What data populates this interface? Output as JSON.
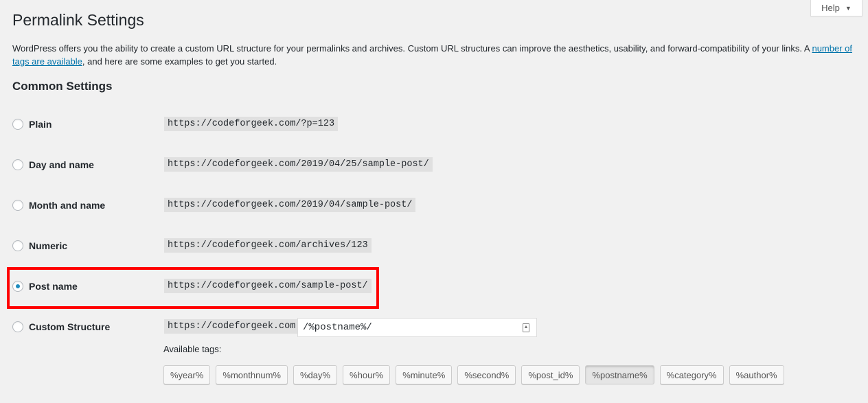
{
  "header": {
    "title": "Permalink Settings",
    "help_label": "Help"
  },
  "description": {
    "text_before": "WordPress offers you the ability to create a custom URL structure for your permalinks and archives. Custom URL structures can improve the aesthetics, usability, and forward-compatibility of your links. A ",
    "link": "number of tags are available",
    "text_after": ", and here are some examples to get you started."
  },
  "section_title": "Common Settings",
  "options": [
    {
      "label": "Plain",
      "example": "https://codeforgeek.com/?p=123",
      "selected": false
    },
    {
      "label": "Day and name",
      "example": "https://codeforgeek.com/2019/04/25/sample-post/",
      "selected": false
    },
    {
      "label": "Month and name",
      "example": "https://codeforgeek.com/2019/04/sample-post/",
      "selected": false
    },
    {
      "label": "Numeric",
      "example": "https://codeforgeek.com/archives/123",
      "selected": false
    },
    {
      "label": "Post name",
      "example": "https://codeforgeek.com/sample-post/",
      "selected": true
    },
    {
      "label": "Custom Structure",
      "example": "https://codeforgeek.com",
      "selected": false
    }
  ],
  "custom": {
    "value": "/%postname%/",
    "available_label": "Available tags:",
    "tags": [
      "%year%",
      "%monthnum%",
      "%day%",
      "%hour%",
      "%minute%",
      "%second%",
      "%post_id%",
      "%postname%",
      "%category%",
      "%author%"
    ],
    "active_tag": "%postname%"
  },
  "colors": {
    "highlight": "#ff0000",
    "link": "#0073aa"
  }
}
